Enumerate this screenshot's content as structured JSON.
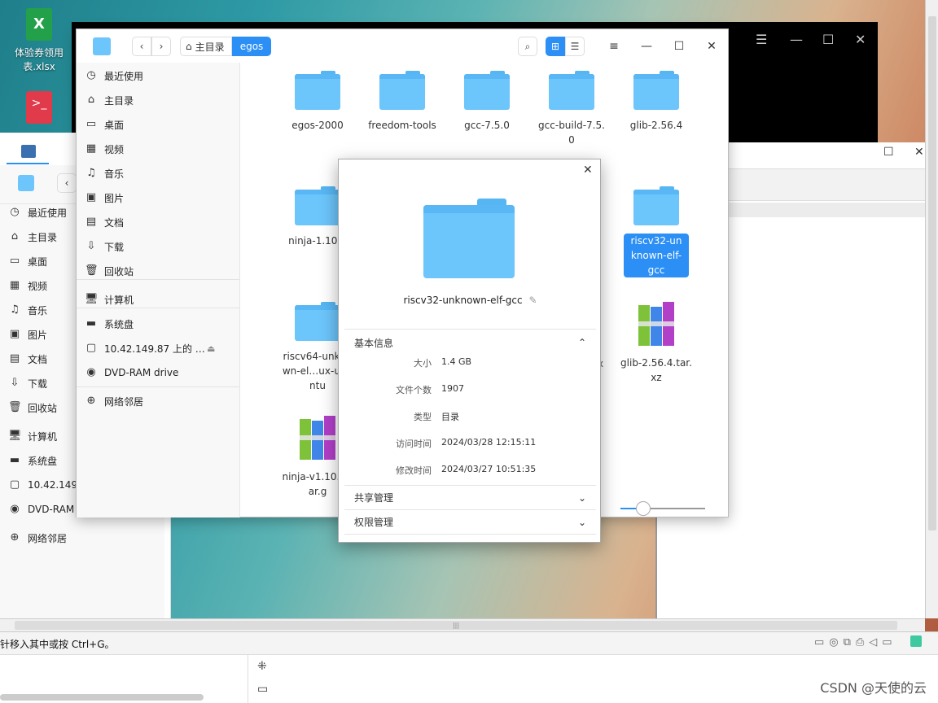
{
  "desktop": {
    "xlsx_label": "体验券领用表.xlsx",
    "xlsx_icon": "excel-file-icon",
    "terminal_icon": "terminal-icon"
  },
  "front": {
    "breadcrumb_home": "主目录",
    "breadcrumb_current": "egos",
    "sidebar": [
      {
        "label": "最近使用",
        "icon": "clock-icon"
      },
      {
        "label": "主目录",
        "icon": "home-icon"
      },
      {
        "label": "桌面",
        "icon": "desktop-icon"
      },
      {
        "label": "视频",
        "icon": "video-icon"
      },
      {
        "label": "音乐",
        "icon": "music-icon"
      },
      {
        "label": "图片",
        "icon": "image-icon"
      },
      {
        "label": "文档",
        "icon": "document-icon"
      },
      {
        "label": "下载",
        "icon": "download-icon"
      },
      {
        "label": "回收站",
        "icon": "trash-icon"
      },
      {
        "label": "计算机",
        "icon": "computer-icon"
      },
      {
        "label": "系统盘",
        "icon": "disk-icon"
      },
      {
        "label": "10.42.149.87 上的 …",
        "icon": "network-share-icon"
      },
      {
        "label": "DVD-RAM drive",
        "icon": "dvd-icon"
      },
      {
        "label": "网络邻居",
        "icon": "network-icon"
      }
    ],
    "files": [
      {
        "name": "egos-2000",
        "type": "folder"
      },
      {
        "name": "freedom-tools",
        "type": "folder"
      },
      {
        "name": "gcc-7.5.0",
        "type": "folder"
      },
      {
        "name": "gcc-build-7.5.0",
        "type": "folder"
      },
      {
        "name": "glib-2.56.4",
        "type": "folder"
      },
      {
        "name": "ninja-1.10.2",
        "type": "folder"
      },
      {
        "name": "riscv32-unknown-elf-gcc",
        "type": "folder",
        "selected": true
      },
      {
        "name": "riscv64-unknown-el…ux-ubuntu",
        "type": "folder"
      },
      {
        "name": "glib-2.56.4.tar.xz",
        "type": "archive"
      },
      {
        "name": "ninja-v1.10.2.tar.g",
        "type": "archive"
      }
    ],
    "zoom_level": 0.27
  },
  "back": {
    "sidebar": [
      {
        "label": "最近使用",
        "icon": "clock-icon"
      },
      {
        "label": "主目录",
        "icon": "home-icon"
      },
      {
        "label": "桌面",
        "icon": "desktop-icon"
      },
      {
        "label": "视频",
        "icon": "video-icon"
      },
      {
        "label": "音乐",
        "icon": "music-icon"
      },
      {
        "label": "图片",
        "icon": "image-icon"
      },
      {
        "label": "文档",
        "icon": "document-icon"
      },
      {
        "label": "下载",
        "icon": "download-icon"
      },
      {
        "label": "回收站",
        "icon": "trash-icon"
      },
      {
        "label": "计算机",
        "icon": "computer-icon"
      },
      {
        "label": "系统盘",
        "icon": "disk-icon"
      },
      {
        "label": "10.42.149",
        "icon": "network-share-icon"
      },
      {
        "label": "DVD-RAM",
        "icon": "dvd-icon"
      },
      {
        "label": "网络邻居",
        "icon": "network-icon"
      }
    ]
  },
  "dialog": {
    "name": "riscv32-unknown-elf-gcc",
    "basic_info": "基本信息",
    "rows": [
      {
        "key": "大小",
        "value": "1.4 GB"
      },
      {
        "key": "文件个数",
        "value": "1907"
      },
      {
        "key": "类型",
        "value": "目录"
      },
      {
        "key": "访问时间",
        "value": "2024/03/28 12:15:11"
      },
      {
        "key": "修改时间",
        "value": "2024/03/27 10:51:35"
      }
    ],
    "share": "共享管理",
    "permission": "权限管理",
    "partial_hint": "x"
  },
  "statusbar": {
    "text": "针移入其中或按 Ctrl+G。",
    "scroll_grip": "|||"
  },
  "watermark": "CSDN @天使的云"
}
